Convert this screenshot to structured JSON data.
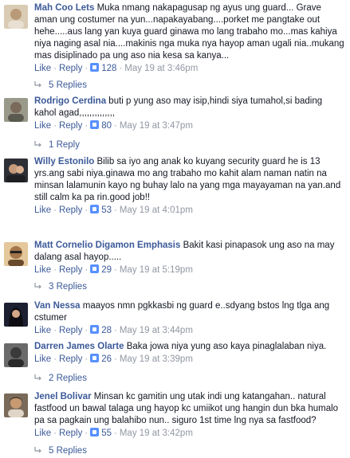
{
  "comments": [
    {
      "author": "Mah Coo Lets",
      "text": "Muka nmang nakapagusap ng ayus ung guard... Grave aman ung costumer na yun...napakayabang....porket me pangtake out hehe.....aus lang yan kuya guard ginawa mo lang trabaho mo...mas kahiya niya naging asal nia....makinis nga muka nya hayop aman ugali nia..mukang mas disiplinado pa ung aso nia kesa sa kanya...",
      "like": "Like",
      "reply": "Reply",
      "likes": "128",
      "time": "May 19 at 3:46pm",
      "replies": "5 Replies",
      "avatar_color": "#c9b79c"
    },
    {
      "author": "Rodrigo Cerdina",
      "text": "buti p yung aso may isip,hindi siya tumahol,si bading kahol agad,,,,,,,,,,,,,,",
      "like": "Like",
      "reply": "Reply",
      "likes": "80",
      "time": "May 19 at 3:47pm",
      "replies": "1 Reply",
      "avatar_color": "#8a8a7a"
    },
    {
      "author": "Willy Estonilo",
      "text": "Bilib sa iyo ang anak ko kuyang security guard he is 13 yrs.ang sabi niya.ginawa mo ang trabaho mo kahit alam naman natin na minsan lalamunin kayo ng buhay lalo na yang mga mayayaman na yan.and still calm ka pa rin.good job!!",
      "like": "Like",
      "reply": "Reply",
      "likes": "53",
      "time": "May 19 at 4:01pm",
      "replies": "",
      "avatar_color": "#3d3f44"
    },
    {
      "author": "Matt Cornelio Digamon Emphasis",
      "text": "Bakit kasi pinapasok ung aso na may dalang asal hayop.....",
      "like": "Like",
      "reply": "Reply",
      "likes": "29",
      "time": "May 19 at 5:19pm",
      "replies": "3 Replies",
      "avatar_color": "#d2a069"
    },
    {
      "author": "Van Nessa",
      "text": "maayos nmn pgkkasbi ng guard e..sdyang bstos lng tlga ang cstumer",
      "like": "Like",
      "reply": "Reply",
      "likes": "28",
      "time": "May 19 at 3:44pm",
      "replies": "",
      "avatar_color": "#2c3040"
    },
    {
      "author": "Darren James Olarte",
      "text": "Baka jowa niya yung aso kaya pinaglalaban niya.",
      "like": "Like",
      "reply": "Reply",
      "likes": "26",
      "time": "May 19 at 3:39pm",
      "replies": "2 Replies",
      "avatar_color": "#4a4a4a"
    },
    {
      "author": "Jenel Bolivar",
      "text": "Minsan kc gamitin ung utak indi ung katangahan.. natural fastfood un bawal talaga ung hayop kc umiikot ung hangin dun bka humalo pa sa pagkain ung balahibo nun.. siguro 1st time lng nya sa fastfood?",
      "like": "Like",
      "reply": "Reply",
      "likes": "55",
      "time": "May 19 at 3:42pm",
      "replies": "5 Replies",
      "avatar_color": "#6b5a4a"
    }
  ]
}
